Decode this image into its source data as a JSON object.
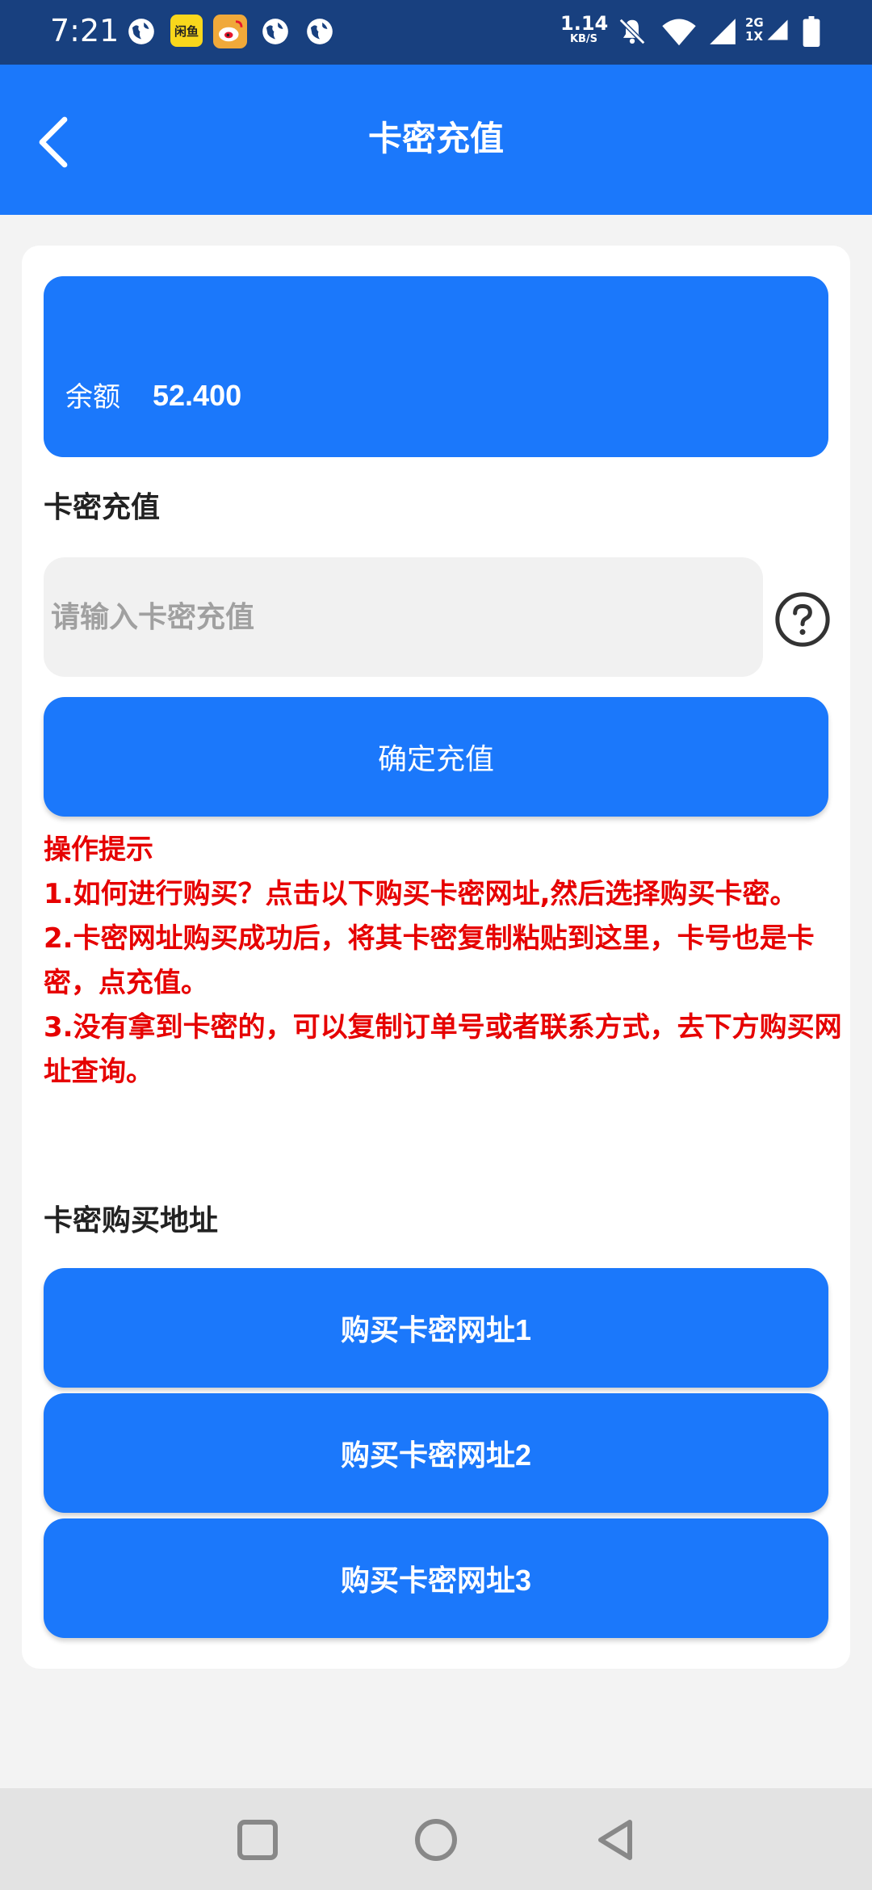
{
  "status_bar": {
    "time": "7:21",
    "net_speed_value": "1.14",
    "net_speed_unit": "KB/S",
    "network_type_top": "2G",
    "network_type_bottom": "1X",
    "app_badge_1": "闲鱼",
    "icons": [
      "globe-icon",
      "xianyu-app-icon",
      "weibo-icon",
      "globe-icon",
      "globe-icon",
      "bell-off-icon",
      "wifi-icon",
      "signal-icon",
      "signal-icon",
      "battery-icon"
    ]
  },
  "header": {
    "title": "卡密充值",
    "back_icon": "chevron-left-icon"
  },
  "balance": {
    "label": "余额",
    "value": "52.400"
  },
  "recharge": {
    "section_label": "卡密充值",
    "input_placeholder": "请输入卡密充值",
    "input_value": "",
    "help_icon": "question-circle-icon",
    "confirm_label": "确定充值"
  },
  "tips": {
    "title": "操作提示",
    "line1": "1.如何进行购买？点击以下购买卡密网址,然后选择购买卡密。",
    "line2": "2.卡密网址购买成功后，将其卡密复制粘贴到这里，卡号也是卡密，点充值。",
    "line3": "3.没有拿到卡密的，可以复制订单号或者联系方式，去下方购买网址查询。"
  },
  "purchase": {
    "section_label": "卡密购买地址",
    "buttons": [
      {
        "label": "购买卡密网址1"
      },
      {
        "label": "购买卡密网址2"
      },
      {
        "label": "购买卡密网址3"
      }
    ]
  },
  "nav_bar": {
    "icons": [
      "recents-square-icon",
      "home-circle-icon",
      "back-triangle-icon"
    ]
  },
  "colors": {
    "status_bar": "#18407f",
    "primary": "#1b78fb",
    "tip_text": "#e60000",
    "background": "#f3f3f3"
  }
}
